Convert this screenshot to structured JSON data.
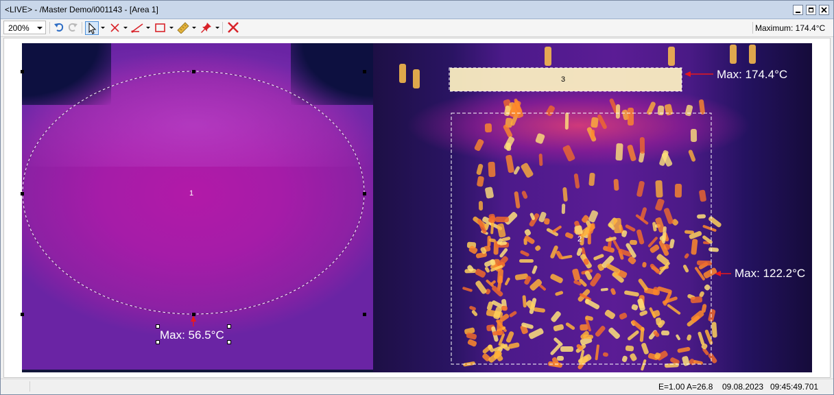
{
  "window": {
    "title": "<LIVE> - /Master Demo/i001143 - [Area 1]"
  },
  "toolbar": {
    "zoom_value": "200%",
    "maximum_label": "Maximum: 174.4°C",
    "tools": [
      "select-cursor",
      "measure-point",
      "measure-line",
      "measure-area",
      "palette-ruler",
      "pin",
      "delete"
    ]
  },
  "image": {
    "rois": [
      {
        "id": "1",
        "shape": "ellipse",
        "label": "Max: 56.5°C"
      },
      {
        "id": "2",
        "shape": "rectangle",
        "label": "Max: 122.2°C"
      },
      {
        "id": "3",
        "shape": "rectangle",
        "label": "Max: 174.4°C"
      }
    ],
    "colors": {
      "roi_arrow": "#e8181c",
      "roi_line": "#ffffff",
      "palette_hot": "#fff3b0",
      "palette_cold": "#1a0c3e"
    }
  },
  "statusbar": {
    "emissivity_ambient": "E=1.00 A=26.8",
    "date": "09.08.2023",
    "time": "09:45:49.701"
  }
}
